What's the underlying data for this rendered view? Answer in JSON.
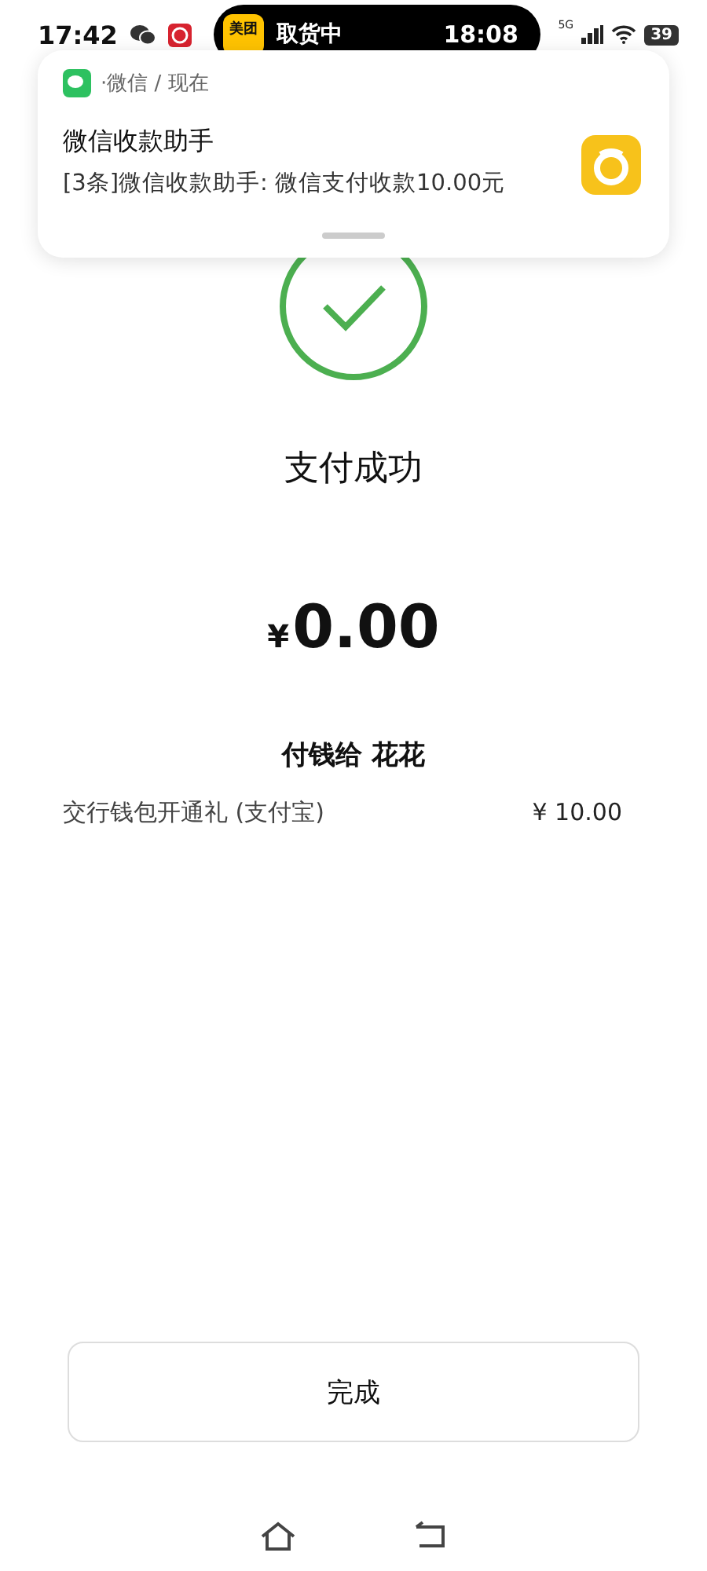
{
  "status_bar": {
    "time": "17:42",
    "live_activity": {
      "app_badge": "美团",
      "status": "取货中",
      "time": "18:08"
    },
    "network": "5G",
    "battery": "39"
  },
  "notification": {
    "source": "·微信 / 现在",
    "title": "微信收款助手",
    "body": "[3条]微信收款助手: 微信支付收款10.00元"
  },
  "result": {
    "title": "支付成功",
    "currency": "¥",
    "amount": "0.00",
    "payee": "付钱给 花花"
  },
  "discounts": [
    {
      "label": "交行钱包开通礼 (支付宝)",
      "value": "¥ 10.00"
    }
  ],
  "done_button": "完成"
}
